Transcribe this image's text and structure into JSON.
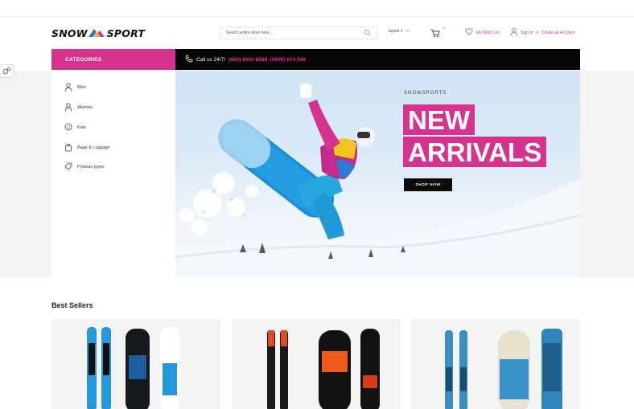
{
  "header": {
    "logo_left": "SNOW",
    "logo_right": "SPORT",
    "search_placeholder": "Search entire store here...",
    "layout_label": "layout 1",
    "cart_count": "0",
    "wishlist_label": "My Wish List",
    "signin_label": "Sign In",
    "or_label": "or",
    "create_account_label": "Create an Account"
  },
  "navbar": {
    "categories_label": "CATEGORIES",
    "call_label": "Call us 24/7!",
    "call_numbers": "(800) 8001-8588, (0600) 874 548"
  },
  "sidebar": {
    "items": [
      {
        "label": "Men",
        "icon": "man-icon"
      },
      {
        "label": "Women",
        "icon": "woman-icon"
      },
      {
        "label": "Kids",
        "icon": "kid-face-icon"
      },
      {
        "label": "Bags & Luggage",
        "icon": "bag-icon"
      },
      {
        "label": "Product types",
        "icon": "tag-icon"
      }
    ]
  },
  "hero": {
    "kicker": "SNOWSPORTS",
    "title_line1": "NEW",
    "title_line2": "ARRIVALS",
    "cta_label": "SHOP NOW"
  },
  "best_sellers": {
    "title": "Best Sellers"
  },
  "colors": {
    "accent": "#d6338f",
    "bar": "#060606"
  }
}
